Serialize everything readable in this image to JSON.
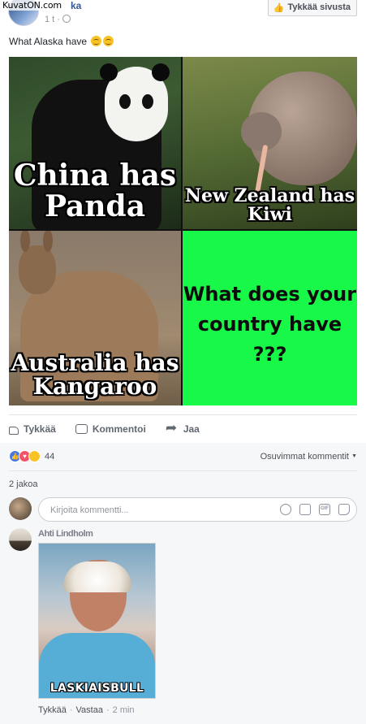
{
  "watermark": "KuvatON.com",
  "post": {
    "page_name": "ka",
    "time": "1 t ·",
    "like_page_label": "Tykkää sivusta",
    "text": "What Alaska have",
    "meme": {
      "panel1": "China has\nPanda",
      "panel2": "New Zealand has\nKiwi",
      "panel3": "Australia has\nKangaroo",
      "panel4": "What does your\ncountry have\n???"
    },
    "actions": {
      "like": "Tykkää",
      "comment": "Kommentoi",
      "share": "Jaa"
    },
    "reactions": {
      "count": "44",
      "types": [
        "like-icon",
        "love-icon",
        "haha-icon"
      ]
    },
    "sort_label": "Osuvimmat kommentit",
    "shares": "2 jakoa",
    "composer": {
      "placeholder": "Kirjoita kommentti..."
    },
    "comment": {
      "author": "Ahti Lindholm",
      "image_caption": "LASKIAISBULL",
      "like_label": "Tykkää",
      "reply_label": "Vastaa",
      "time": "2 min"
    }
  },
  "colors": {
    "link": "#365899",
    "meme_green": "#18f848",
    "background_gray": "#f6f7f9"
  }
}
